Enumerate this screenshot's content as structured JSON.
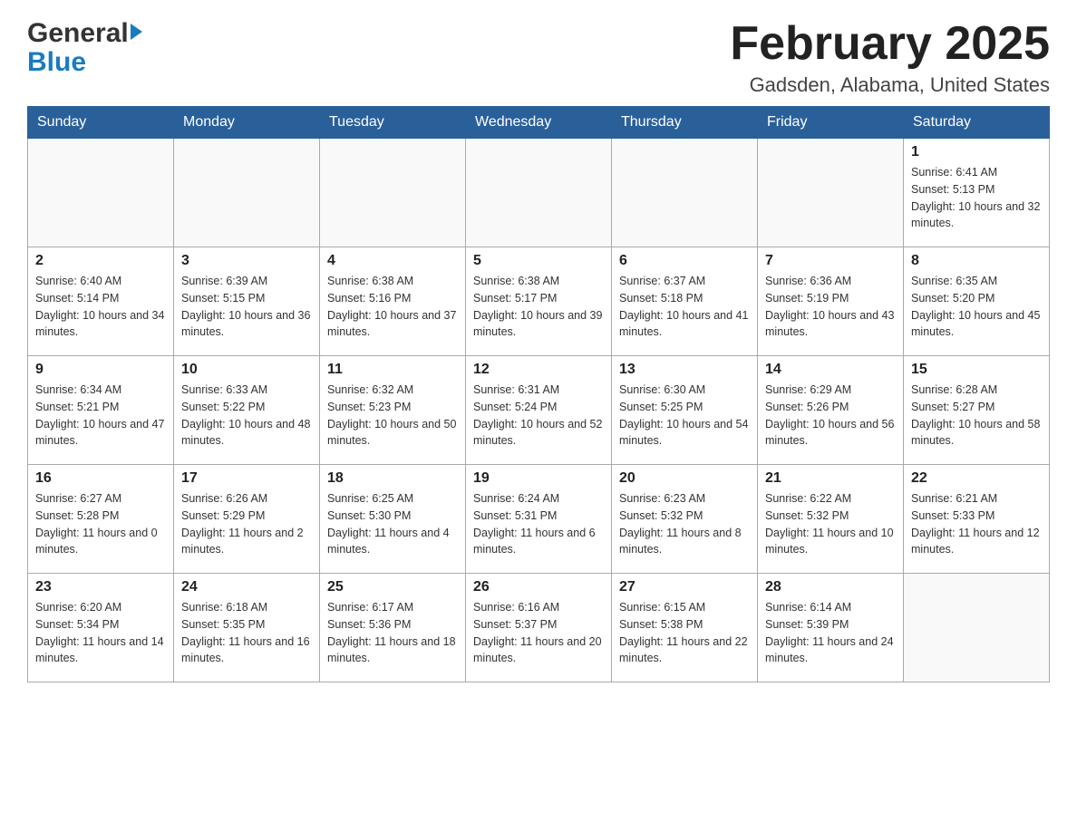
{
  "header": {
    "logo_general": "General",
    "logo_blue": "Blue",
    "month_title": "February 2025",
    "location": "Gadsden, Alabama, United States"
  },
  "weekdays": [
    "Sunday",
    "Monday",
    "Tuesday",
    "Wednesday",
    "Thursday",
    "Friday",
    "Saturday"
  ],
  "weeks": [
    [
      {
        "day": "",
        "sunrise": "",
        "sunset": "",
        "daylight": ""
      },
      {
        "day": "",
        "sunrise": "",
        "sunset": "",
        "daylight": ""
      },
      {
        "day": "",
        "sunrise": "",
        "sunset": "",
        "daylight": ""
      },
      {
        "day": "",
        "sunrise": "",
        "sunset": "",
        "daylight": ""
      },
      {
        "day": "",
        "sunrise": "",
        "sunset": "",
        "daylight": ""
      },
      {
        "day": "",
        "sunrise": "",
        "sunset": "",
        "daylight": ""
      },
      {
        "day": "1",
        "sunrise": "Sunrise: 6:41 AM",
        "sunset": "Sunset: 5:13 PM",
        "daylight": "Daylight: 10 hours and 32 minutes."
      }
    ],
    [
      {
        "day": "2",
        "sunrise": "Sunrise: 6:40 AM",
        "sunset": "Sunset: 5:14 PM",
        "daylight": "Daylight: 10 hours and 34 minutes."
      },
      {
        "day": "3",
        "sunrise": "Sunrise: 6:39 AM",
        "sunset": "Sunset: 5:15 PM",
        "daylight": "Daylight: 10 hours and 36 minutes."
      },
      {
        "day": "4",
        "sunrise": "Sunrise: 6:38 AM",
        "sunset": "Sunset: 5:16 PM",
        "daylight": "Daylight: 10 hours and 37 minutes."
      },
      {
        "day": "5",
        "sunrise": "Sunrise: 6:38 AM",
        "sunset": "Sunset: 5:17 PM",
        "daylight": "Daylight: 10 hours and 39 minutes."
      },
      {
        "day": "6",
        "sunrise": "Sunrise: 6:37 AM",
        "sunset": "Sunset: 5:18 PM",
        "daylight": "Daylight: 10 hours and 41 minutes."
      },
      {
        "day": "7",
        "sunrise": "Sunrise: 6:36 AM",
        "sunset": "Sunset: 5:19 PM",
        "daylight": "Daylight: 10 hours and 43 minutes."
      },
      {
        "day": "8",
        "sunrise": "Sunrise: 6:35 AM",
        "sunset": "Sunset: 5:20 PM",
        "daylight": "Daylight: 10 hours and 45 minutes."
      }
    ],
    [
      {
        "day": "9",
        "sunrise": "Sunrise: 6:34 AM",
        "sunset": "Sunset: 5:21 PM",
        "daylight": "Daylight: 10 hours and 47 minutes."
      },
      {
        "day": "10",
        "sunrise": "Sunrise: 6:33 AM",
        "sunset": "Sunset: 5:22 PM",
        "daylight": "Daylight: 10 hours and 48 minutes."
      },
      {
        "day": "11",
        "sunrise": "Sunrise: 6:32 AM",
        "sunset": "Sunset: 5:23 PM",
        "daylight": "Daylight: 10 hours and 50 minutes."
      },
      {
        "day": "12",
        "sunrise": "Sunrise: 6:31 AM",
        "sunset": "Sunset: 5:24 PM",
        "daylight": "Daylight: 10 hours and 52 minutes."
      },
      {
        "day": "13",
        "sunrise": "Sunrise: 6:30 AM",
        "sunset": "Sunset: 5:25 PM",
        "daylight": "Daylight: 10 hours and 54 minutes."
      },
      {
        "day": "14",
        "sunrise": "Sunrise: 6:29 AM",
        "sunset": "Sunset: 5:26 PM",
        "daylight": "Daylight: 10 hours and 56 minutes."
      },
      {
        "day": "15",
        "sunrise": "Sunrise: 6:28 AM",
        "sunset": "Sunset: 5:27 PM",
        "daylight": "Daylight: 10 hours and 58 minutes."
      }
    ],
    [
      {
        "day": "16",
        "sunrise": "Sunrise: 6:27 AM",
        "sunset": "Sunset: 5:28 PM",
        "daylight": "Daylight: 11 hours and 0 minutes."
      },
      {
        "day": "17",
        "sunrise": "Sunrise: 6:26 AM",
        "sunset": "Sunset: 5:29 PM",
        "daylight": "Daylight: 11 hours and 2 minutes."
      },
      {
        "day": "18",
        "sunrise": "Sunrise: 6:25 AM",
        "sunset": "Sunset: 5:30 PM",
        "daylight": "Daylight: 11 hours and 4 minutes."
      },
      {
        "day": "19",
        "sunrise": "Sunrise: 6:24 AM",
        "sunset": "Sunset: 5:31 PM",
        "daylight": "Daylight: 11 hours and 6 minutes."
      },
      {
        "day": "20",
        "sunrise": "Sunrise: 6:23 AM",
        "sunset": "Sunset: 5:32 PM",
        "daylight": "Daylight: 11 hours and 8 minutes."
      },
      {
        "day": "21",
        "sunrise": "Sunrise: 6:22 AM",
        "sunset": "Sunset: 5:32 PM",
        "daylight": "Daylight: 11 hours and 10 minutes."
      },
      {
        "day": "22",
        "sunrise": "Sunrise: 6:21 AM",
        "sunset": "Sunset: 5:33 PM",
        "daylight": "Daylight: 11 hours and 12 minutes."
      }
    ],
    [
      {
        "day": "23",
        "sunrise": "Sunrise: 6:20 AM",
        "sunset": "Sunset: 5:34 PM",
        "daylight": "Daylight: 11 hours and 14 minutes."
      },
      {
        "day": "24",
        "sunrise": "Sunrise: 6:18 AM",
        "sunset": "Sunset: 5:35 PM",
        "daylight": "Daylight: 11 hours and 16 minutes."
      },
      {
        "day": "25",
        "sunrise": "Sunrise: 6:17 AM",
        "sunset": "Sunset: 5:36 PM",
        "daylight": "Daylight: 11 hours and 18 minutes."
      },
      {
        "day": "26",
        "sunrise": "Sunrise: 6:16 AM",
        "sunset": "Sunset: 5:37 PM",
        "daylight": "Daylight: 11 hours and 20 minutes."
      },
      {
        "day": "27",
        "sunrise": "Sunrise: 6:15 AM",
        "sunset": "Sunset: 5:38 PM",
        "daylight": "Daylight: 11 hours and 22 minutes."
      },
      {
        "day": "28",
        "sunrise": "Sunrise: 6:14 AM",
        "sunset": "Sunset: 5:39 PM",
        "daylight": "Daylight: 11 hours and 24 minutes."
      },
      {
        "day": "",
        "sunrise": "",
        "sunset": "",
        "daylight": ""
      }
    ]
  ]
}
